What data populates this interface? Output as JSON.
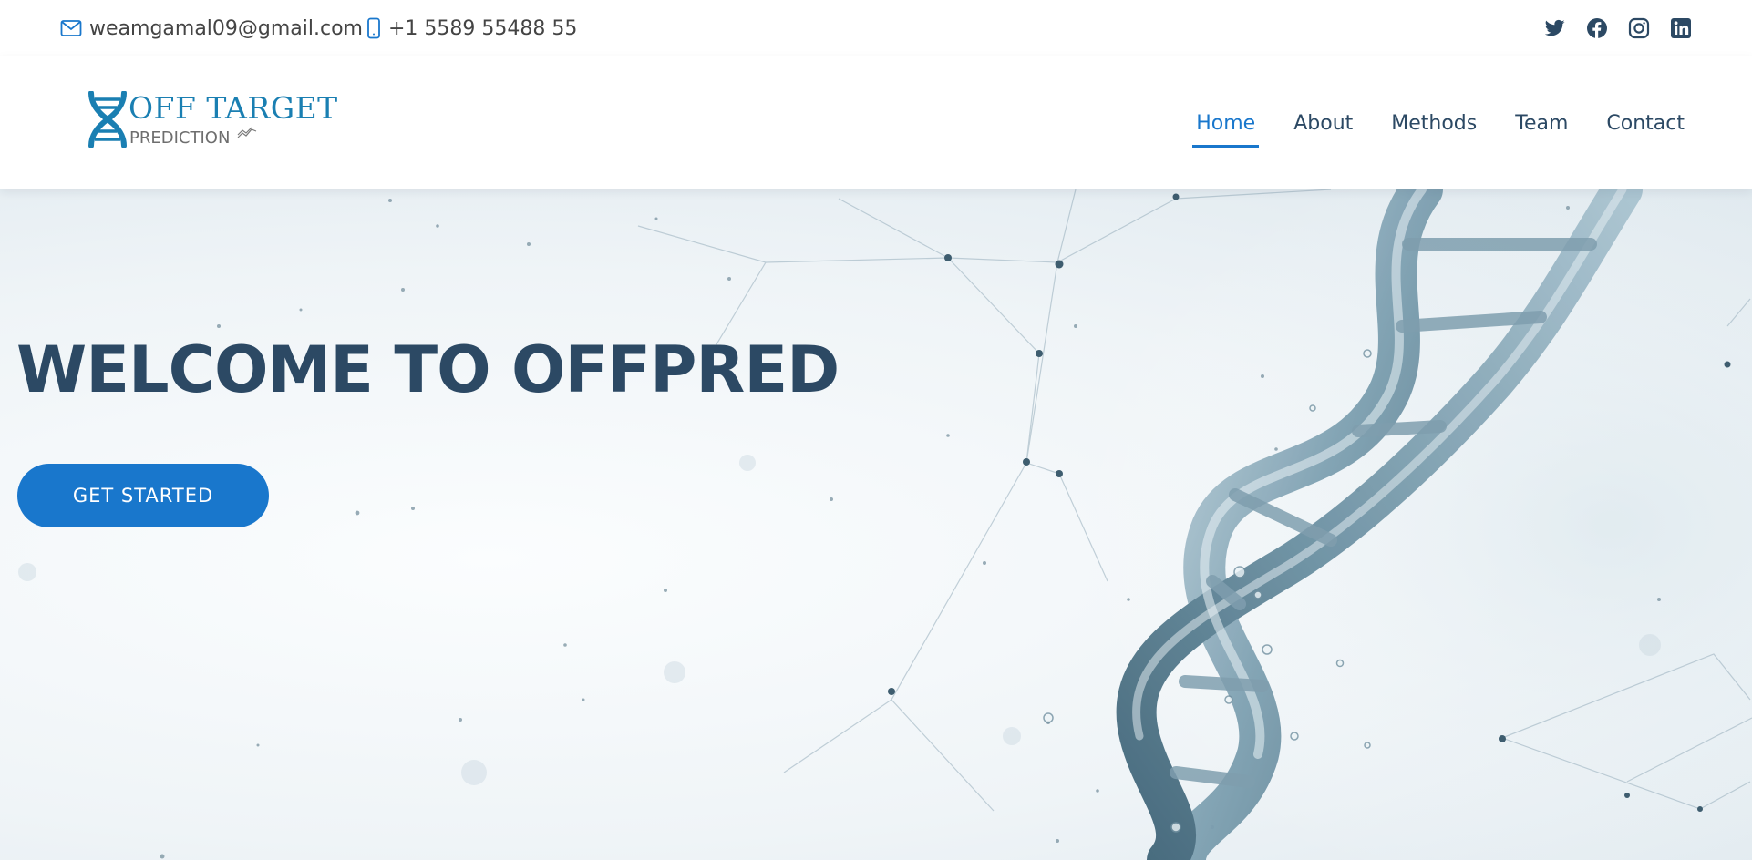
{
  "topbar": {
    "email": "weamgamal09@gmail.com",
    "phone": "+1 5589 55488 55",
    "socials": [
      "twitter-icon",
      "facebook-icon",
      "instagram-icon",
      "linkedin-icon"
    ]
  },
  "header": {
    "logo_top": "OFF TARGET",
    "logo_bottom": "PREDICTION",
    "nav": [
      {
        "label": "Home",
        "active": true
      },
      {
        "label": "About",
        "active": false
      },
      {
        "label": "Methods",
        "active": false
      },
      {
        "label": "Team",
        "active": false
      },
      {
        "label": "Contact",
        "active": false
      }
    ]
  },
  "hero": {
    "title": "WELCOME TO OFFPRED",
    "cta_label": "GET STARTED"
  },
  "colors": {
    "accent": "#1977cc",
    "heading": "#2c4964",
    "logo": "#1a7fb2"
  }
}
